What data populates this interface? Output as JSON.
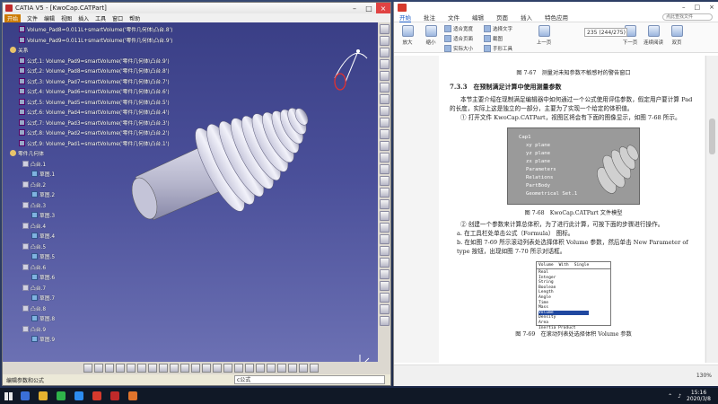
{
  "catia": {
    "window_title": "CATIA V5 - [KwoCap.CATPart]",
    "menu": [
      "开始",
      "文件",
      "编辑",
      "视图",
      "插入",
      "工具",
      "窗口",
      "帮助"
    ],
    "tree": [
      {
        "icon": "formula",
        "text": "Volume_Pad8=0.011L+smartVolume('零件几何体\\凸台.8')"
      },
      {
        "icon": "formula",
        "text": "Volume_Pad9=0.011L+smartVolume('零件几何体\\凸台.9')"
      },
      {
        "icon": "gear",
        "text": "关系"
      },
      {
        "icon": "formula",
        "text": "公式.1: Volume_Pad9=smartVolume('零件几何体\\凸台.9')"
      },
      {
        "icon": "formula",
        "text": "公式.2: Volume_Pad8=smartVolume('零件几何体\\凸台.8')"
      },
      {
        "icon": "formula",
        "text": "公式.3: Volume_Pad7=smartVolume('零件几何体\\凸台.7')"
      },
      {
        "icon": "formula",
        "text": "公式.4: Volume_Pad6=smartVolume('零件几何体\\凸台.6')"
      },
      {
        "icon": "formula",
        "text": "公式.5: Volume_Pad5=smartVolume('零件几何体\\凸台.5')"
      },
      {
        "icon": "formula",
        "text": "公式.6: Volume_Pad4=smartVolume('零件几何体\\凸台.4')"
      },
      {
        "icon": "formula",
        "text": "公式.7: Volume_Pad3=smartVolume('零件几何体\\凸台.3')"
      },
      {
        "icon": "formula",
        "text": "公式.8: Volume_Pad2=smartVolume('零件几何体\\凸台.2')"
      },
      {
        "icon": "formula",
        "text": "公式.9: Volume_Pad1=smartVolume('零件几何体\\凸台.1')"
      },
      {
        "icon": "gear",
        "text": "零件几何体"
      },
      {
        "icon": "body",
        "text": "凸台.1"
      },
      {
        "icon": "sketch",
        "text": "草图.1"
      },
      {
        "icon": "body",
        "text": "凸台.2"
      },
      {
        "icon": "sketch",
        "text": "草图.2"
      },
      {
        "icon": "body",
        "text": "凸台.3"
      },
      {
        "icon": "sketch",
        "text": "草图.3"
      },
      {
        "icon": "body",
        "text": "凸台.4"
      },
      {
        "icon": "sketch",
        "text": "草图.4"
      },
      {
        "icon": "body",
        "text": "凸台.5"
      },
      {
        "icon": "sketch",
        "text": "草图.5"
      },
      {
        "icon": "body",
        "text": "凸台.6"
      },
      {
        "icon": "sketch",
        "text": "草图.6"
      },
      {
        "icon": "body",
        "text": "凸台.7"
      },
      {
        "icon": "sketch",
        "text": "草图.7"
      },
      {
        "icon": "body",
        "text": "凸台.8"
      },
      {
        "icon": "sketch",
        "text": "草图.8"
      },
      {
        "icon": "body",
        "text": "凸台.9"
      },
      {
        "icon": "sketch",
        "text": "草图.9"
      }
    ],
    "status_text": "编辑参数和公式",
    "command_input": "c公式",
    "logo": "CATIA"
  },
  "pdf": {
    "tabs": [
      "批注",
      "文件",
      "编辑",
      "页面",
      "插入",
      "特色应用"
    ],
    "active_tab": "开始",
    "search_placeholder": "点此查找文件",
    "ribbon": {
      "big": [
        "放大",
        "缩小"
      ],
      "small_a": [
        "适合宽度",
        "适合页面",
        "实际大小"
      ],
      "small_b": [
        "选择文字",
        "截图",
        "手形工具"
      ],
      "page_value": "235 (244/275)",
      "nav": [
        "上一页",
        "下一页"
      ],
      "right": [
        "连续阅读",
        "双页"
      ]
    },
    "content": {
      "caption_top": "图 7-67　测量对未知参数不敏感时的警告窗口",
      "section": "7.3.3　在预制满足计算中使用测量参数",
      "para1": "本节主要介绍在现制满足编辑器中如何通过一个公式使用评估参数，假定用户要计算 Pad 的长度，实际上这是独立的一部分，主要为了实现一个给定的体积值。",
      "step1": "① 打开文件 KwoCap.CATPart，视图区将会有下面的图像显示，如图 7-68 所示。",
      "fig1_lines": [
        "Cap1",
        "xy plane",
        "yz plane",
        "zx plane",
        "Parameters",
        "Relations",
        "PartBody",
        "Geometrical Set.1"
      ],
      "fig1_caption": "图 7-68　KwoCap.CATPart 文件模型",
      "step2": "② 创建一个参数来计算总体积，为了进行此计算，可按下面的步骤进行操作。",
      "step2a": "a. 在工具栏处单击公式（Formula）  图标。",
      "step2b": "b. 在如图 7-69 所示滚动列表处选择体积 Volume 参数，然后单击 New Parameter of type 按钮，出现如图 7-70 所示对话框。",
      "fig2_head": [
        "Volume",
        "With",
        "Single"
      ],
      "fig2_list": [
        "Real",
        "Integer",
        "String",
        "Boolean",
        "Length",
        "Angle",
        "Time",
        "Mass",
        "Volume",
        "Density",
        "Area",
        "Inertia Product"
      ],
      "fig2_selected": "Volume",
      "fig2_caption": "图 7-69　在滚动列表处选择体积 Volume 参数"
    },
    "zoom": "130%"
  },
  "taskbar": {
    "time": "15:16",
    "date": "2020/3/8"
  }
}
